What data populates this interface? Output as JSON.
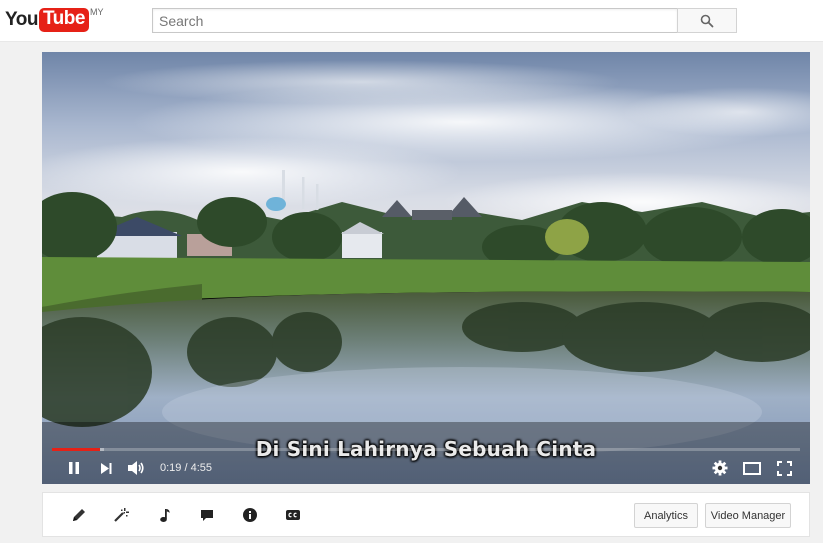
{
  "masthead": {
    "logo_you": "You",
    "logo_tube": "Tube",
    "logo_region": "MY",
    "search": {
      "placeholder": "Search",
      "value": ""
    },
    "icons": {
      "search_button": "search-icon"
    }
  },
  "player": {
    "subtitle": "Di Sini Lahirnya Sebuah Cinta",
    "current_time": "0:19",
    "duration": "4:55",
    "time_separator": " / ",
    "progress_played_fraction": 0.0644,
    "progress_loaded_fraction": 0.07,
    "controls": {
      "play_state": "playing",
      "icons": [
        "pause-icon",
        "next-icon",
        "volume-icon",
        "settings-icon",
        "theater-icon",
        "fullscreen-icon"
      ]
    }
  },
  "toolbar": {
    "tools": [
      "pencil-icon",
      "magic-wand-icon",
      "music-note-icon",
      "comment-icon",
      "info-icon",
      "cc-icon"
    ],
    "analytics_label": "Analytics",
    "video_manager_label": "Video Manager"
  },
  "colors": {
    "brand_red": "#e62117",
    "progress_red": "#e62117",
    "masthead_bg": "#ffffff",
    "page_bg": "#f1f1f1"
  }
}
